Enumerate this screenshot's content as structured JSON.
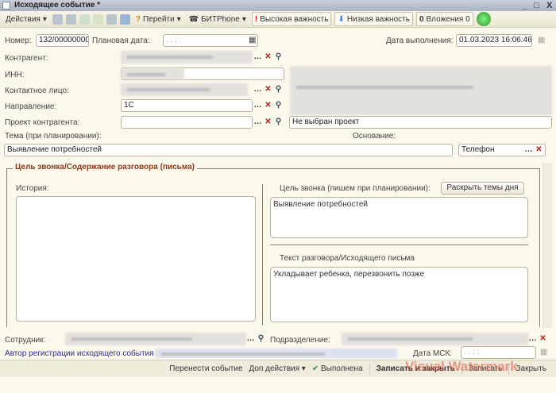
{
  "window": {
    "title": "Исходящее событие *",
    "min": "_",
    "max": "□",
    "close": "X"
  },
  "toolbar": {
    "actions": "Действия",
    "goto": "Перейти",
    "bitphone": "БИТPhone",
    "high": "Высокая важность",
    "low": "Низкая важность",
    "attachments": "Вложения 0"
  },
  "header": {
    "number_label": "Номер:",
    "number": "132/00000000",
    "plan_label": "Плановая дата:",
    "plan_value": ". .   : :",
    "done_label": "Дата выполнения:",
    "done_value": "01.03.2023 16:06:46"
  },
  "form": {
    "contractor_label": "Контрагент:",
    "inn_label": "ИНН:",
    "contact_label": "Контактное лицо:",
    "direction_label": "Направление:",
    "direction": "1С",
    "project_label": "Проект контрагента:",
    "project": "",
    "project_note": "Не выбран проект",
    "topic_label": "Тема (при планировании):",
    "topic": "Выявление потребностей",
    "basis_label": "Основание:",
    "basis": "Телефон"
  },
  "group": {
    "title": "Цель звонка/Содержание разговора (письма)",
    "history_label": "История:",
    "purpose_label": "Цель звонка (пишем при планировании):",
    "expand_button": "Раскрыть темы дня",
    "purpose": "Выявление потребностей",
    "text_label": "Текст разговора/Исходящего письма",
    "text": "Укладывает ребенка, перезвонить позже"
  },
  "footer": {
    "employee_label": "Сотрудник:",
    "dept_label": "Подразделение:",
    "author_link": "Автор регистрации исходящего события",
    "msk_label": "Дата МСК:",
    "msk_value": ". .   : :"
  },
  "bottom": {
    "move": "Перенести событие",
    "more": "Доп действия",
    "done": "Выполнена",
    "save_close": "Записать и закрыть",
    "save": "Записать",
    "close": "Закрыть"
  },
  "watermark": "Visual Watermark"
}
